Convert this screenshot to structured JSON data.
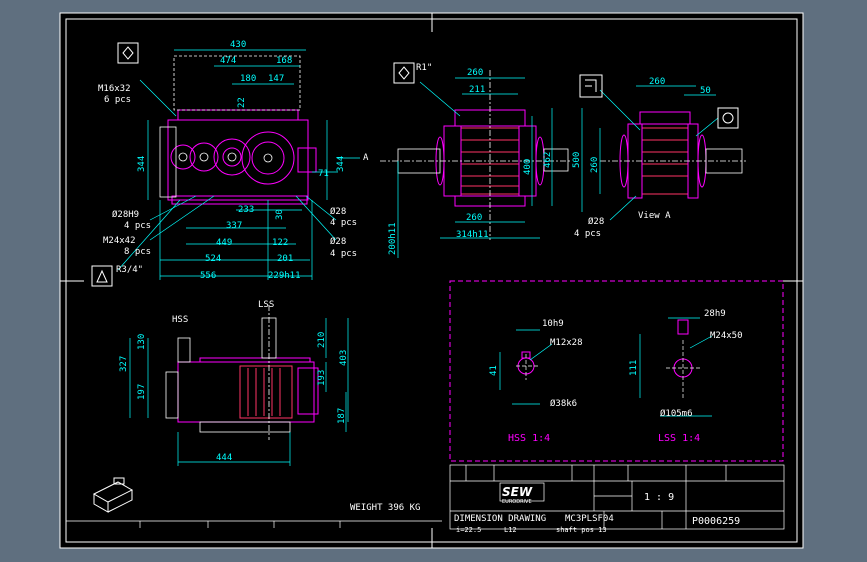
{
  "colors": {
    "viewport": "#5f6f7f",
    "sheet": "#000000",
    "border": "#ffffff",
    "dimension": "#00ffff",
    "detail": "#ff00ff",
    "section": "#ff3366"
  },
  "front_view": {
    "dims": {
      "d430": "430",
      "d474": "474",
      "d168": "168",
      "d180": "180",
      "d147": "147",
      "d22": "22",
      "d344_left": "344",
      "d344_right": "344",
      "arrow_a": "A",
      "d71": "71",
      "d233": "233",
      "d337": "337",
      "d30": "30",
      "d449": "449",
      "d122": "122",
      "d524": "524",
      "d201": "201",
      "d556": "556",
      "d229": "229h11"
    },
    "notes": {
      "m16_line1": "M16x32",
      "m16_line2": "6 pcs",
      "d28h9_line1": "Ø28H9",
      "d28h9_line2": "4 pcs",
      "m24_line1": "M24x42",
      "m24_line2": "8 pcs",
      "r34": "R3/4\"",
      "d28a_line1": "Ø28",
      "d28a_line2": "4 pcs",
      "d28b_line1": "Ø28",
      "d28b_line2": "4 pcs"
    }
  },
  "side_view": {
    "dims": {
      "r1": "R1\"",
      "d260_top": "260",
      "d211": "211",
      "d400": "400",
      "d462": "462",
      "d260_bottom": "260",
      "d314": "314h11",
      "d200": "200h11"
    }
  },
  "view_a": {
    "dims": {
      "d260": "260",
      "d50": "50",
      "d500": "500",
      "d260_left": "260"
    },
    "notes": {
      "d28_line1": "Ø28",
      "d28_line2": "4 pcs",
      "title": "View A"
    }
  },
  "bottom_view": {
    "labels": {
      "hss": "HSS",
      "lss": "LSS"
    },
    "dims": {
      "d327": "327",
      "d130": "130",
      "d197": "197",
      "d210": "210",
      "d403": "403",
      "d193": "193",
      "d187": "187",
      "d444": "444"
    }
  },
  "detail_panel": {
    "hss": {
      "key": "10h9",
      "thread": "M12x28",
      "height": "41",
      "dia": "Ø38k6",
      "caption": "HSS 1:4"
    },
    "lss": {
      "key": "28h9",
      "thread": "M24x50",
      "height": "111",
      "dia": "Ø105m6",
      "caption": "LSS 1:4"
    }
  },
  "weight": "WEIGHT 396 KG",
  "title_block": {
    "brand": "SEW",
    "brand_sub": "EURODRIVE",
    "scale": "1 : 9",
    "title": "DIMENSION DRAWING",
    "model": "MC3PLSF04",
    "ratio": "i=22.5",
    "code": "L12",
    "shaft": "shaft pos 13",
    "drawing_no": "P0006259"
  }
}
